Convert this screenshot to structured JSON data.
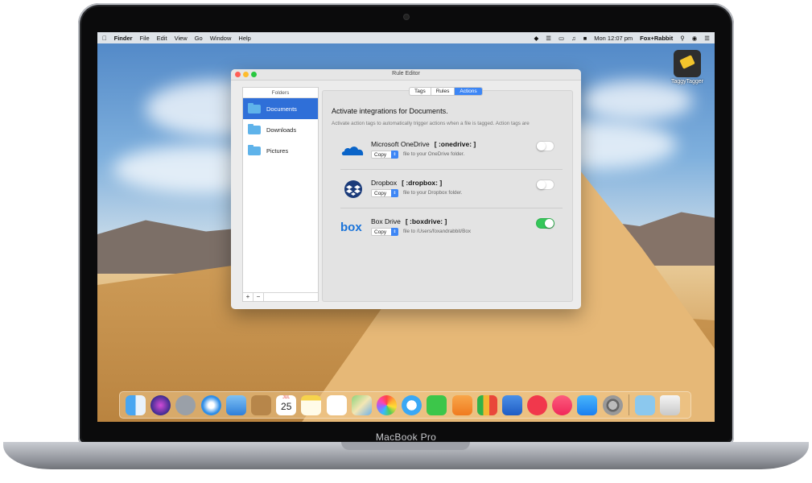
{
  "laptop": {
    "brand": "MacBook Pro"
  },
  "menubar": {
    "app": "Finder",
    "items": [
      "File",
      "Edit",
      "View",
      "Go",
      "Window",
      "Help"
    ],
    "clock": "Mon 12:07 pm",
    "user": "Fox+Rabbit"
  },
  "desktop": {
    "icon_label": "TaggyTagger"
  },
  "window": {
    "title": "Rule Editor",
    "sidebar": {
      "header": "Folders",
      "items": [
        "Documents",
        "Downloads",
        "Pictures"
      ],
      "add": "+",
      "remove": "−"
    },
    "tabs": [
      "Tags",
      "Rules",
      "Actions"
    ],
    "active_tab": "Actions",
    "heading": "Activate integrations for Documents.",
    "subheading": "Activate action tags to automatically trigger actions when a file is tagged. Action tags are",
    "services": [
      {
        "name": "Microsoft OneDrive",
        "tag": "[ :onedrive: ]",
        "action": "Copy",
        "desc": "file to your OneDrive folder.",
        "enabled": false,
        "icon": "onedrive-icon"
      },
      {
        "name": "Dropbox",
        "tag": "[ :dropbox: ]",
        "action": "Copy",
        "desc": "file to your Dropbox folder.",
        "enabled": false,
        "icon": "dropbox-icon"
      },
      {
        "name": "Box Drive",
        "tag": "[ :boxdrive: ]",
        "action": "Copy",
        "desc": "file to /Users/foxandrabbit/Box",
        "enabled": true,
        "icon": "box-icon",
        "logo_text": "box"
      }
    ]
  },
  "colors": {
    "accent": "#3d86f5",
    "selection": "#2f6fd8",
    "toggle_on": "#34c759",
    "folder": "#5fb3ea"
  },
  "dock": {
    "icons": [
      "finder-icon",
      "siri-icon",
      "launchpad-icon",
      "safari-icon",
      "mail-icon",
      "contacts-icon",
      "calendar-icon",
      "notes-icon",
      "reminders-icon",
      "maps-icon",
      "photos-icon",
      "messages-icon",
      "facetime-icon",
      "pages-icon",
      "numbers-icon",
      "keynote-icon",
      "news-icon",
      "music-icon",
      "appstore-icon",
      "preferences-icon",
      "downloads-folder-icon",
      "trash-icon"
    ],
    "calendar_month": "JUL",
    "calendar_day": "25"
  }
}
